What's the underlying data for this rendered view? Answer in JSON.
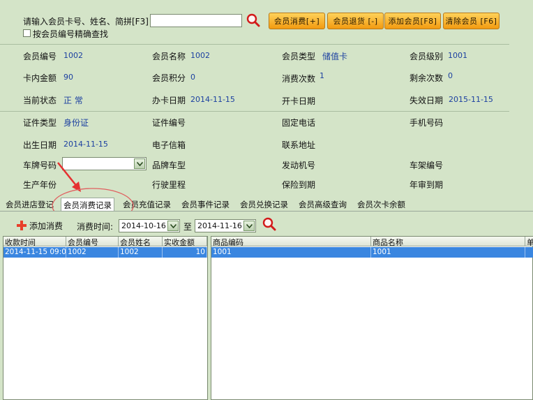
{
  "search": {
    "label": "请输入会员卡号、姓名、简拼[F3]",
    "value": "",
    "exact_label": "按会员编号精确查找"
  },
  "buttons": {
    "consume": "会员消费[+]",
    "return": "会员退货 [-]",
    "add": "添加会员[F8]",
    "clear": "清除会员 [F6]"
  },
  "info": {
    "member_no_label": "会员编号",
    "member_no": "1002",
    "member_name_label": "会员名称",
    "member_name": "1002",
    "member_type_label": "会员类型",
    "member_type": "储值卡",
    "member_level_label": "会员级别",
    "member_level": "1001",
    "balance_label": "卡内金额",
    "balance": "90",
    "points_label": "会员积分",
    "points": "0",
    "consume_count_label": "消费次数",
    "consume_count": "1",
    "remaining_label": "剩余次数",
    "remaining": "0",
    "status_label": "当前状态",
    "status": "正 常",
    "issue_date_label": "办卡日期",
    "issue_date": "2014-11-15",
    "open_date_label": "开卡日期",
    "open_date": "",
    "expire_label": "失效日期",
    "expire_date": "2015-11-15",
    "id_type_label": "证件类型",
    "id_type": "身份证",
    "id_no_label": "证件编号",
    "phone_label": "固定电话",
    "mobile_label": "手机号码",
    "birth_label": "出生日期",
    "birth": "2014-11-15",
    "email_label": "电子信箱",
    "address_label": "联系地址",
    "plate_label": "车牌号码",
    "brand_label": "品牌车型",
    "engine_label": "发动机号",
    "frame_label": "车架编号",
    "year_label": "生产年份",
    "mileage_label": "行驶里程",
    "insurance_label": "保险到期",
    "inspection_label": "年审到期"
  },
  "tabs": [
    "会员进店登记",
    "会员消费记录",
    "会员充值记录",
    "会员事件记录",
    "会员兑换记录",
    "会员高级查询",
    "会员次卡余额"
  ],
  "subbar": {
    "add_label": "添加消费",
    "time_label": "消费时间:",
    "from": "2014-10-16",
    "to_label": "至",
    "to": "2014-11-16"
  },
  "left_grid": {
    "headers": [
      "收款时间",
      "会员编号",
      "会员姓名",
      "实收金额"
    ],
    "rows": [
      [
        "2014-11-15 09:0",
        "1002",
        "1002",
        "10"
      ]
    ]
  },
  "right_grid": {
    "headers": [
      "商品编码",
      "商品名称",
      "单"
    ],
    "rows": [
      [
        "1001",
        "1001",
        ""
      ]
    ]
  },
  "colors": {
    "bg": "#d4e4c8",
    "accent": "#f5a623",
    "value": "#1b3fa0",
    "selected": "#3a86e0"
  }
}
